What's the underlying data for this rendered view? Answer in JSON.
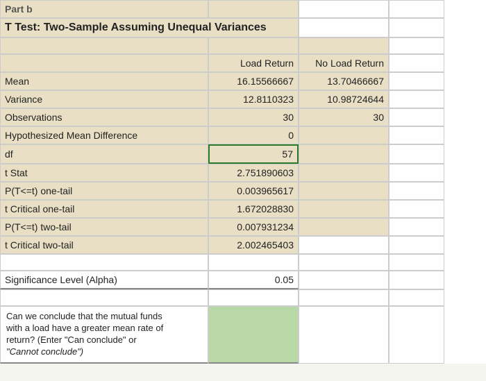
{
  "part_label": "Part b",
  "title": "T Test: Two-Sample Assuming Unequal Variances",
  "headers": {
    "col1": "Load Return",
    "col2": "No Load Return"
  },
  "stats": [
    {
      "label": "Mean",
      "v1": "16.15566667",
      "v2": "13.70466667"
    },
    {
      "label": "Variance",
      "v1": "12.8110323",
      "v2": "10.98724644"
    },
    {
      "label": "Observations",
      "v1": "30",
      "v2": "30"
    },
    {
      "label": "Hypothesized Mean Difference",
      "v1": "0",
      "v2": ""
    },
    {
      "label": "df",
      "v1": "57",
      "v2": ""
    },
    {
      "label": "t Stat",
      "v1": "2.751890603",
      "v2": ""
    },
    {
      "label": "P(T<=t) one-tail",
      "v1": "0.003965617",
      "v2": ""
    },
    {
      "label": "t Critical one-tail",
      "v1": "1.672028830",
      "v2": ""
    },
    {
      "label": "P(T<=t) two-tail",
      "v1": "0.007931234",
      "v2": ""
    },
    {
      "label": "t Critical two-tail",
      "v1": "2.002465403",
      "v2": ""
    }
  ],
  "alpha": {
    "label": "Significance Level (Alpha)",
    "value": "0.05"
  },
  "question": {
    "line1": "Can we conclude that the mutual funds",
    "line2": "with a load have a greater mean rate of",
    "line3": "return? (Enter \"Can conclude\" or",
    "line4": "\"Cannot conclude\")"
  }
}
